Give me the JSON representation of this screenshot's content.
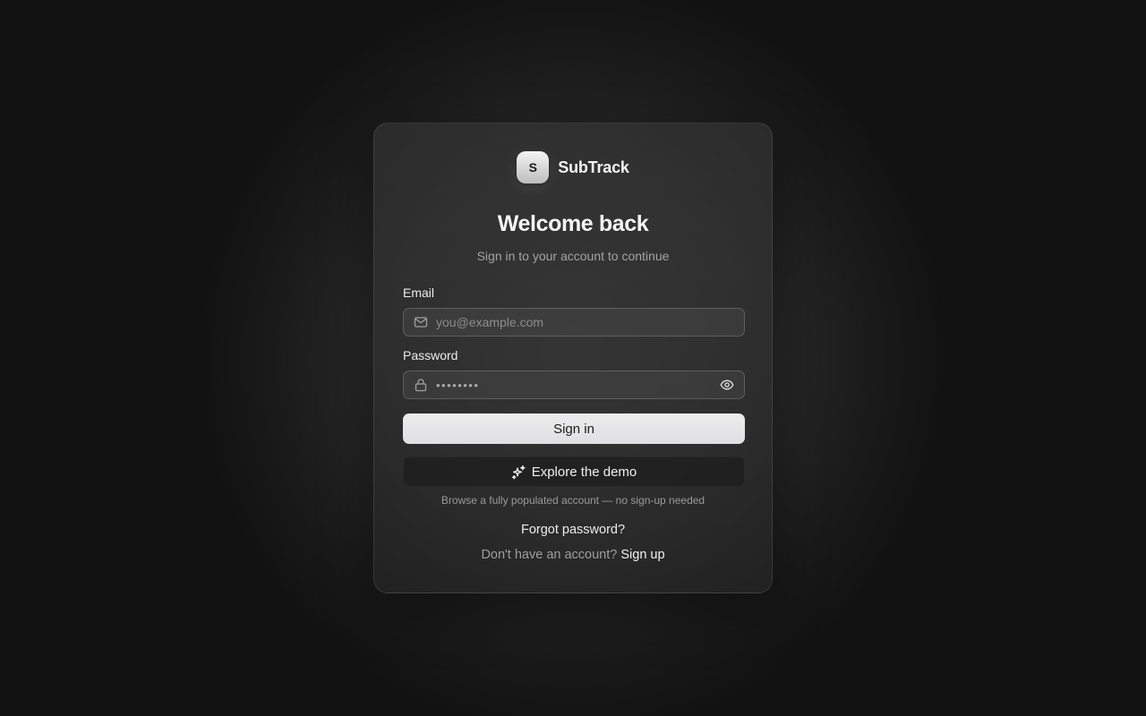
{
  "brand": {
    "logo_letter": "S",
    "name": "SubTrack"
  },
  "header": {
    "title": "Welcome back",
    "subtitle": "Sign in to your account to continue"
  },
  "form": {
    "email_label": "Email",
    "email_placeholder": "you@example.com",
    "email_value": "",
    "password_label": "Password",
    "password_value_masked": "••••••••"
  },
  "actions": {
    "sign_in_label": "Sign in",
    "demo_label": "Explore the demo",
    "demo_hint": "Browse a fully populated account — no sign-up needed",
    "forgot_label": "Forgot password?",
    "no_account_text": "Don't have an account?",
    "sign_up_label": "Sign up"
  },
  "icons": {
    "email": "mail-icon",
    "password": "lock-icon",
    "toggle_password": "eye-icon",
    "demo": "sparkles-icon"
  },
  "colors": {
    "primary_button_bg": "#e6e6e8",
    "primary_button_text": "#1c1c1c",
    "card_border": "#3c3c3c",
    "muted_text": "#a3a3a3"
  }
}
